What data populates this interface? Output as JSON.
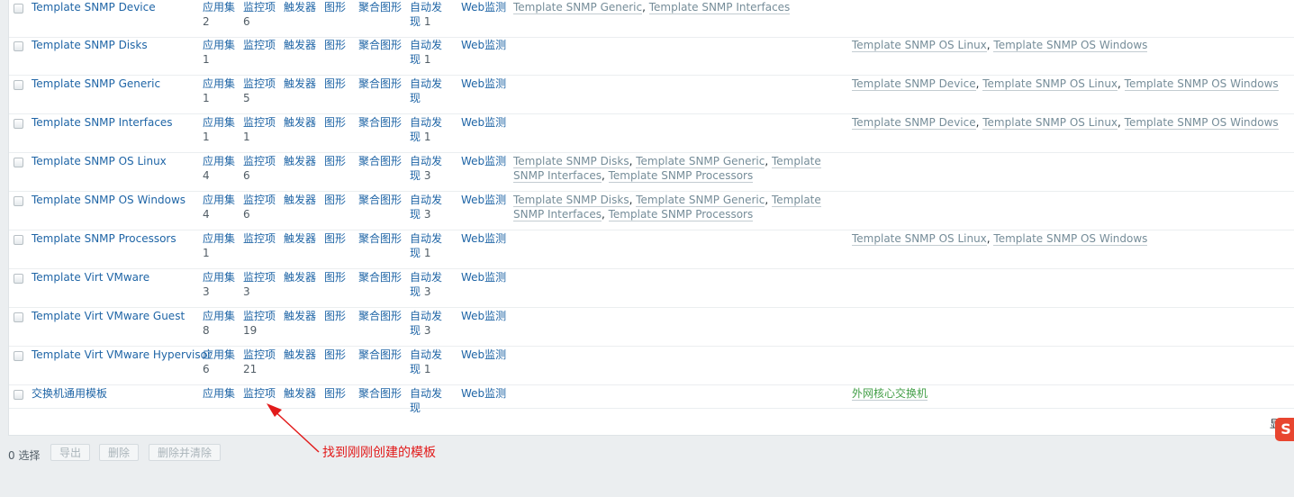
{
  "rows": [
    {
      "name": "Template SNMP Device",
      "app": "应用集",
      "app_n": "2",
      "items": "监控项",
      "items_n": "6",
      "triggers": "触发器",
      "graphs": "图形",
      "screens": "聚合图形",
      "discovery": "自动发现",
      "discovery_n": "1",
      "web": "Web监测",
      "linked": [
        "Template SNMP Generic",
        "Template SNMP Interfaces"
      ],
      "linked_to": []
    },
    {
      "name": "Template SNMP Disks",
      "app": "应用集",
      "app_n": "1",
      "items": "监控项",
      "items_n": "",
      "triggers": "触发器",
      "graphs": "图形",
      "screens": "聚合图形",
      "discovery": "自动发现",
      "discovery_n": "1",
      "web": "Web监测",
      "linked": [],
      "linked_to": [
        "Template SNMP OS Linux",
        "Template SNMP OS Windows"
      ]
    },
    {
      "name": "Template SNMP Generic",
      "app": "应用集",
      "app_n": "1",
      "items": "监控项",
      "items_n": "5",
      "triggers": "触发器",
      "graphs": "图形",
      "screens": "聚合图形",
      "discovery": "自动发现",
      "discovery_n": "",
      "web": "Web监测",
      "linked": [],
      "linked_to": [
        "Template SNMP Device",
        "Template SNMP OS Linux",
        "Template SNMP OS Windows"
      ]
    },
    {
      "name": "Template SNMP Interfaces",
      "app": "应用集",
      "app_n": "1",
      "items": "监控项",
      "items_n": "1",
      "triggers": "触发器",
      "graphs": "图形",
      "screens": "聚合图形",
      "discovery": "自动发现",
      "discovery_n": "1",
      "web": "Web监测",
      "linked": [],
      "linked_to": [
        "Template SNMP Device",
        "Template SNMP OS Linux",
        "Template SNMP OS Windows"
      ]
    },
    {
      "name": "Template SNMP OS Linux",
      "app": "应用集",
      "app_n": "4",
      "items": "监控项",
      "items_n": "6",
      "triggers": "触发器",
      "graphs": "图形",
      "screens": "聚合图形",
      "discovery": "自动发现",
      "discovery_n": "3",
      "web": "Web监测",
      "linked": [
        "Template SNMP Disks",
        "Template SNMP Generic",
        "Template SNMP Interfaces",
        "Template SNMP Processors"
      ],
      "linked_to": []
    },
    {
      "name": "Template SNMP OS Windows",
      "app": "应用集",
      "app_n": "4",
      "items": "监控项",
      "items_n": "6",
      "triggers": "触发器",
      "graphs": "图形",
      "screens": "聚合图形",
      "discovery": "自动发现",
      "discovery_n": "3",
      "web": "Web监测",
      "linked": [
        "Template SNMP Disks",
        "Template SNMP Generic",
        "Template SNMP Interfaces",
        "Template SNMP Processors"
      ],
      "linked_to": []
    },
    {
      "name": "Template SNMP Processors",
      "app": "应用集",
      "app_n": "1",
      "items": "监控项",
      "items_n": "",
      "triggers": "触发器",
      "graphs": "图形",
      "screens": "聚合图形",
      "discovery": "自动发现",
      "discovery_n": "1",
      "web": "Web监测",
      "linked": [],
      "linked_to": [
        "Template SNMP OS Linux",
        "Template SNMP OS Windows"
      ]
    },
    {
      "name": "Template Virt VMware",
      "app": "应用集",
      "app_n": "3",
      "items": "监控项",
      "items_n": "3",
      "triggers": "触发器",
      "graphs": "图形",
      "screens": "聚合图形",
      "discovery": "自动发现",
      "discovery_n": "3",
      "web": "Web监测",
      "linked": [],
      "linked_to": []
    },
    {
      "name": "Template Virt VMware Guest",
      "app": "应用集",
      "app_n": "8",
      "items": "监控项",
      "items_n": "19",
      "triggers": "触发器",
      "graphs": "图形",
      "screens": "聚合图形",
      "discovery": "自动发现",
      "discovery_n": "3",
      "web": "Web监测",
      "linked": [],
      "linked_to": []
    },
    {
      "name": "Template Virt VMware Hypervisor",
      "app": "应用集",
      "app_n": "6",
      "items": "监控项",
      "items_n": "21",
      "triggers": "触发器",
      "graphs": "图形",
      "screens": "聚合图形",
      "discovery": "自动发现",
      "discovery_n": "1",
      "web": "Web监测",
      "linked": [],
      "linked_to": []
    },
    {
      "name": "交换机通用模板",
      "app": "应用集",
      "app_n": "",
      "items": "监控项",
      "items_n": "",
      "triggers": "触发器",
      "graphs": "图形",
      "screens": "聚合图形",
      "discovery": "自动发现",
      "discovery_n": "",
      "web": "Web监测",
      "linked": [],
      "linked_to": [
        "外网核心交换机"
      ]
    }
  ],
  "side_text": "显",
  "logo_glyph": "S",
  "footer": {
    "selected_count": "0 选择",
    "export_label": "导出",
    "delete_label": "删除",
    "delete_clear_label": "删除并清除"
  },
  "annotation": {
    "text": "找到刚刚创建的模板",
    "color": "#e21b1b"
  }
}
